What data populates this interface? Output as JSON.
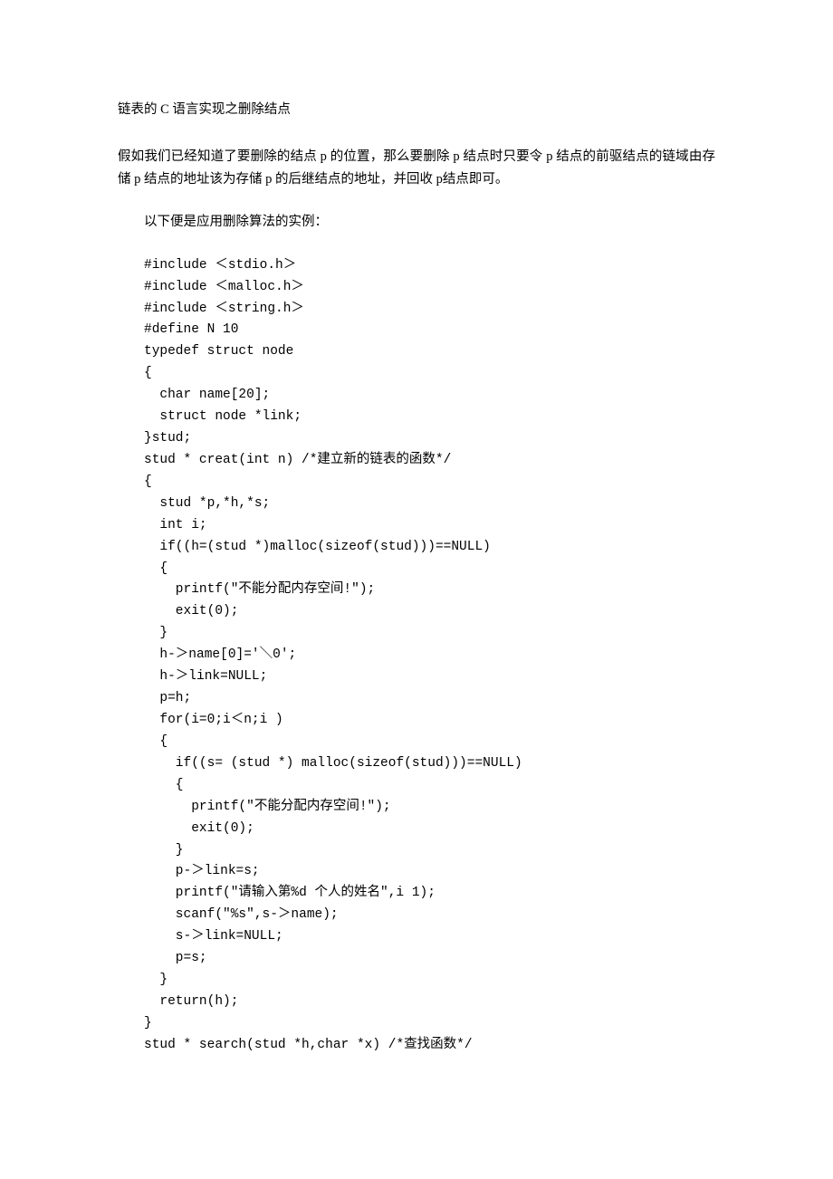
{
  "title": "链表的 C 语言实现之删除结点",
  "intro": "假如我们已经知道了要删除的结点 p 的位置，那么要删除 p 结点时只要令 p 结点的前驱结点的链域由存储 p 结点的地址该为存储 p 的后继结点的地址，并回收 p结点即可。",
  "subheading": "以下便是应用删除算法的实例：",
  "code": "#include ＜stdio.h＞\n#include ＜malloc.h＞\n#include ＜string.h＞\n#define N 10\ntypedef struct node\n{\n  char name[20];\n  struct node *link;\n}stud;\nstud * creat(int n) /*建立新的链表的函数*/\n{\n  stud *p,*h,*s;\n  int i;\n  if((h=(stud *)malloc(sizeof(stud)))==NULL)\n  {\n    printf(\"不能分配内存空间!\");\n    exit(0);\n  }\n  h-＞name[0]='＼0';\n  h-＞link=NULL;\n  p=h;\n  for(i=0;i＜n;i )\n  {\n    if((s= (stud *) malloc(sizeof(stud)))==NULL)\n    {\n      printf(\"不能分配内存空间!\");\n      exit(0);\n    }\n    p-＞link=s;\n    printf(\"请输入第%d 个人的姓名\",i 1);\n    scanf(\"%s\",s-＞name);\n    s-＞link=NULL;\n    p=s;\n  }\n  return(h);\n}\nstud * search(stud *h,char *x) /*查找函数*/"
}
